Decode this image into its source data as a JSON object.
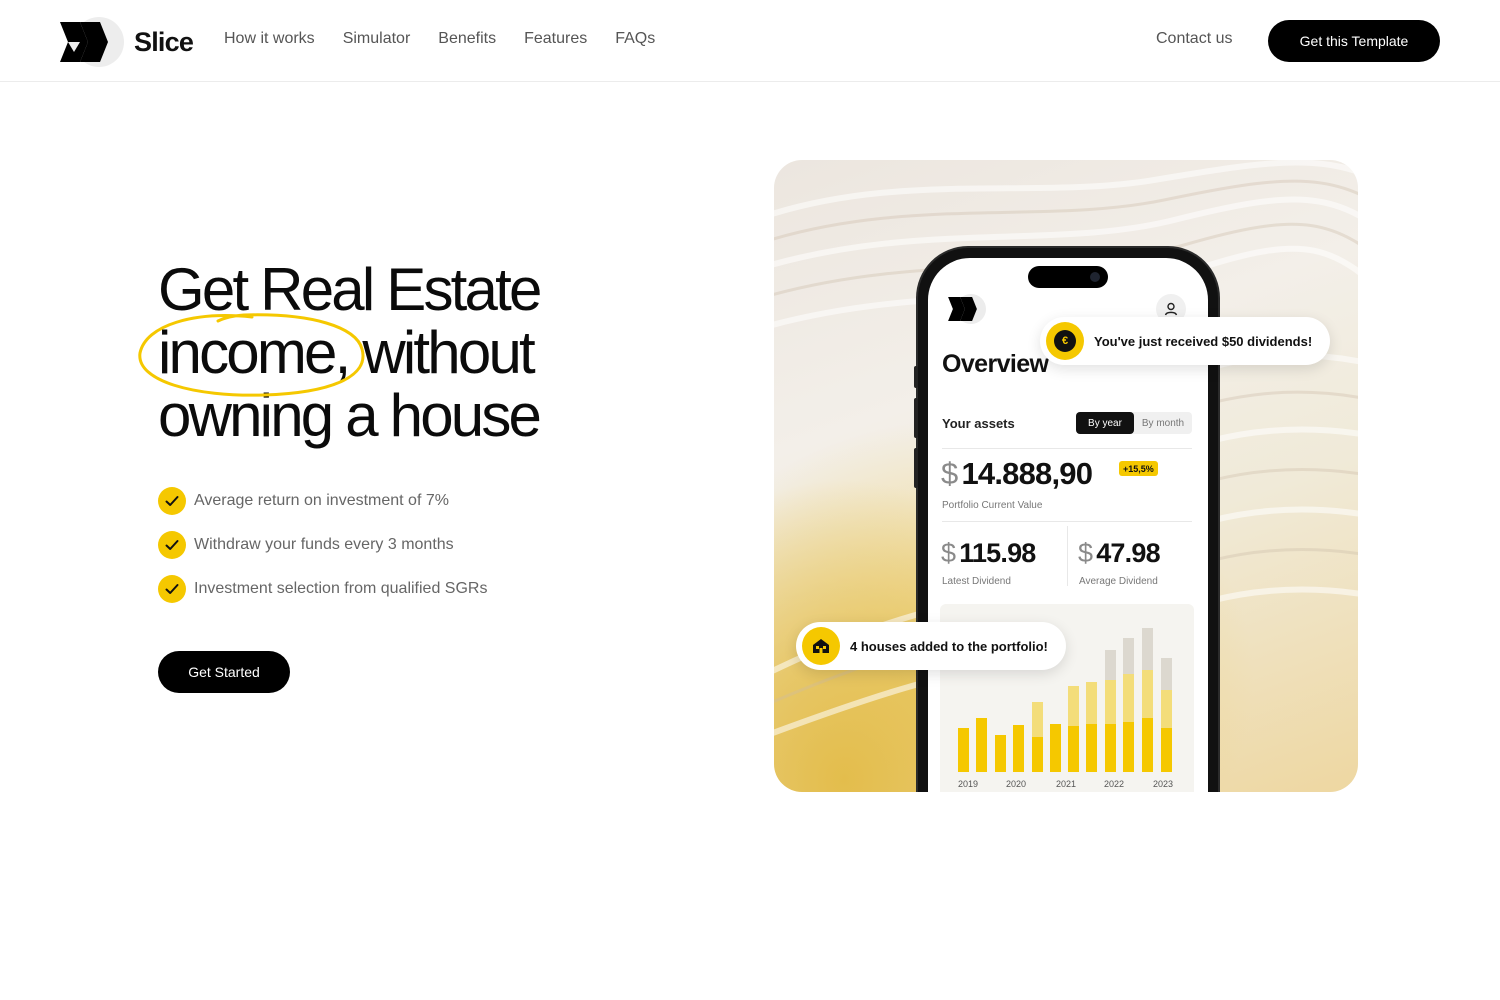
{
  "nav": {
    "brand": "Slice",
    "links": [
      "How it works",
      "Simulator",
      "Benefits",
      "Features",
      "FAQs"
    ],
    "contact": "Contact us",
    "cta": "Get this Template"
  },
  "hero": {
    "headline_line1": "Get Real Estate",
    "headline_highlight": "income,",
    "headline_line2_rest": " without",
    "headline_line3": "owning a house",
    "benefits": [
      "Average return on investment of 7%",
      "Withdraw your funds every 3 months",
      "Investment selection from qualified SGRs"
    ],
    "cta": "Get Started"
  },
  "app": {
    "title": "Overview",
    "assets_label": "Your assets",
    "toggle": [
      "By year",
      "By month"
    ],
    "currency": "$",
    "portfolio_value": "14.888,90",
    "portfolio_change": "+15,5%",
    "portfolio_label": "Portfolio Current Value",
    "latest_dividend": "115.98",
    "latest_label": "Latest Dividend",
    "average_dividend": "47.98",
    "average_label": "Average Dividend",
    "chart_years": [
      "2019",
      "2020",
      "2021",
      "2022",
      "2023"
    ]
  },
  "toasts": {
    "dividend": "You've just received $50 dividends!",
    "dividend_icon": "€",
    "houses": "4 houses added to the portfolio!"
  },
  "colors": {
    "accent": "#f5c800",
    "accent_light": "#f3dd7a",
    "bar_gray": "#dcd8cf",
    "text_dark": "#111111",
    "text_muted": "#666666"
  }
}
